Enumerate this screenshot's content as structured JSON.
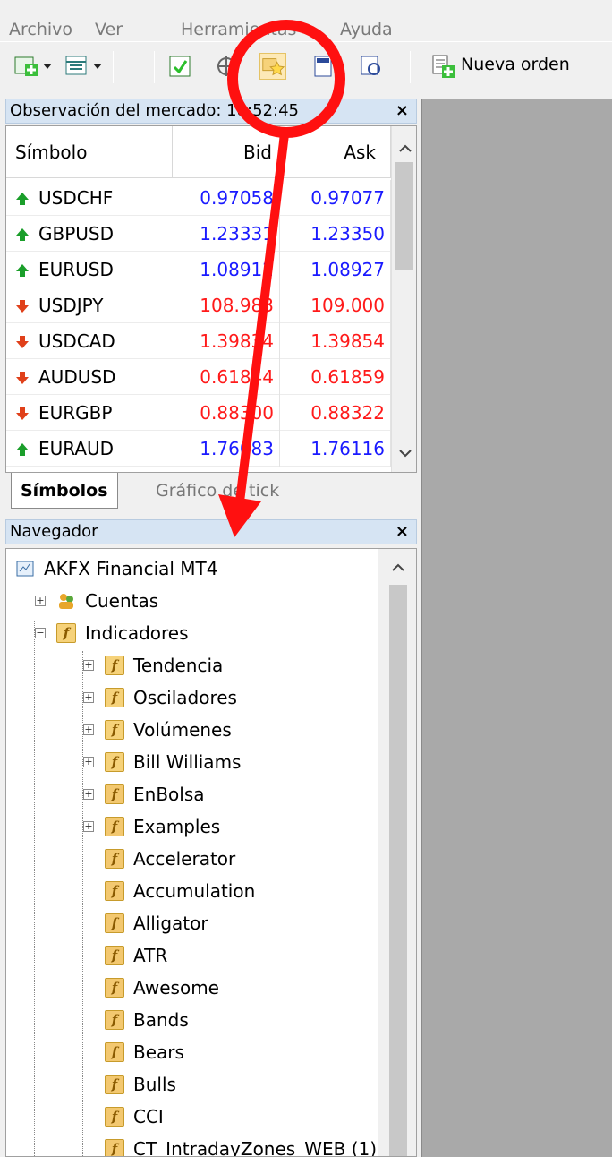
{
  "menu": {
    "items": [
      "Archivo",
      "Ver",
      "Herramientas",
      "Ayuda"
    ]
  },
  "toolbar": {
    "new_order_label": "Nueva orden"
  },
  "market_watch": {
    "title": "Observación del mercado: 18:52:45",
    "columns": {
      "symbol": "Símbolo",
      "bid": "Bid",
      "ask": "Ask"
    },
    "rows": [
      {
        "symbol": "USDCHF",
        "bid": "0.97058",
        "ask": "0.97077",
        "direction": "up"
      },
      {
        "symbol": "GBPUSD",
        "bid": "1.23331",
        "ask": "1.23350",
        "direction": "up"
      },
      {
        "symbol": "EURUSD",
        "bid": "1.08912",
        "ask": "1.08927",
        "direction": "up"
      },
      {
        "symbol": "USDJPY",
        "bid": "108.983",
        "ask": "109.000",
        "direction": "down"
      },
      {
        "symbol": "USDCAD",
        "bid": "1.39834",
        "ask": "1.39854",
        "direction": "down"
      },
      {
        "symbol": "AUDUSD",
        "bid": "0.61844",
        "ask": "0.61859",
        "direction": "down"
      },
      {
        "symbol": "EURGBP",
        "bid": "0.88300",
        "ask": "0.88322",
        "direction": "down"
      },
      {
        "symbol": "EURAUD",
        "bid": "1.76083",
        "ask": "1.76116",
        "direction": "up"
      }
    ]
  },
  "tabs": {
    "symbols": "Símbolos",
    "tick_chart": "Gráfico de tick"
  },
  "navigator": {
    "title": "Navegador",
    "root": "AKFX Financial MT4",
    "accounts": "Cuentas",
    "indicators": "Indicadores",
    "indicator_groups": [
      "Tendencia",
      "Osciladores",
      "Volúmenes",
      "Bill Williams",
      "EnBolsa",
      "Examples"
    ],
    "indicator_items": [
      "Accelerator",
      "Accumulation",
      "Alligator",
      "ATR",
      "Awesome",
      "Bands",
      "Bears",
      "Bulls",
      "CCI",
      "CT_IntradayZones_WEB (1)"
    ]
  },
  "colors": {
    "up": "#1a9e2a",
    "down": "#e0401a",
    "bid_up": "#1a1aff",
    "bid_down": "#ff1a1a",
    "annotation": "#ff1010",
    "header_bg": "#d6e4f3"
  },
  "icons": {
    "close": "close-icon",
    "up": "arrow-up-icon",
    "down": "arrow-down-icon"
  }
}
